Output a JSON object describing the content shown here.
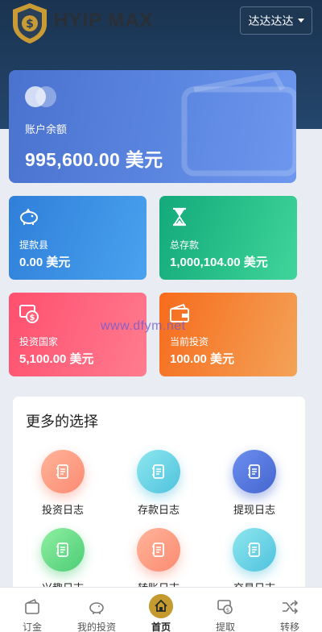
{
  "header": {
    "brand": "HYIP MAX",
    "user_menu_label": "达达达达",
    "logo_icon": "shield-dollar-icon"
  },
  "balance_card": {
    "label": "账户余额",
    "amount": "995,600.00 美元"
  },
  "stats": [
    {
      "label": "提款县",
      "value": "0.00 美元",
      "icon": "piggy-bank-icon",
      "color": "#3a90e4"
    },
    {
      "label": "总存款",
      "value": "1,000,104.00 美元",
      "icon": "hourglass-icon",
      "color": "#22be88"
    },
    {
      "label": "投资国家",
      "value": "5,100.00 美元",
      "icon": "money-dollar-icon",
      "color": "#ff6079"
    },
    {
      "label": "当前投资",
      "value": "100.00 美元",
      "icon": "wallet-icon",
      "color": "#f5853a"
    }
  ],
  "watermark": "www.dfym.net",
  "more_options": {
    "title": "更多的选择",
    "items": [
      {
        "label": "投资日志",
        "icon": "document-icon",
        "color": "#fb8b72"
      },
      {
        "label": "存款日志",
        "icon": "document-icon",
        "color": "#4fc2de"
      },
      {
        "label": "提现日志",
        "icon": "document-icon",
        "color": "#4365cf"
      },
      {
        "label": "兴趣日志",
        "icon": "document-icon",
        "color": "#4ccc76"
      },
      {
        "label": "转账日志",
        "icon": "document-icon",
        "color": "#fb8b72"
      },
      {
        "label": "交易日志",
        "icon": "document-icon",
        "color": "#4fc2de"
      }
    ]
  },
  "tabbar": [
    {
      "label": "订金",
      "icon": "wallet-outline-icon",
      "active": false
    },
    {
      "label": "我的投资",
      "icon": "piggy-bank-icon",
      "active": false
    },
    {
      "label": "首页",
      "icon": "home-icon",
      "active": true
    },
    {
      "label": "提取",
      "icon": "withdraw-icon",
      "active": false
    },
    {
      "label": "转移",
      "icon": "shuffle-icon",
      "active": false
    }
  ]
}
